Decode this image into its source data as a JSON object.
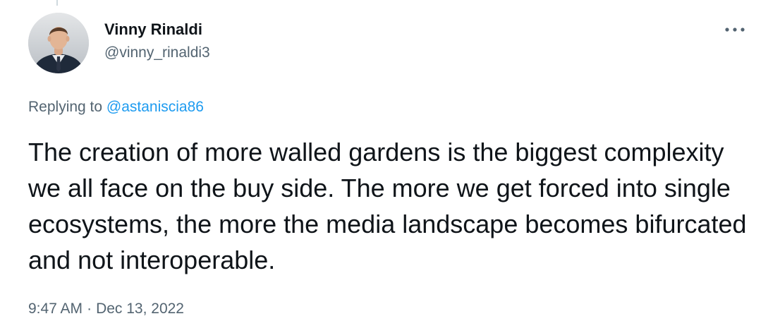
{
  "author": {
    "display_name": "Vinny Rinaldi",
    "handle": "@vinny_rinaldi3"
  },
  "reply": {
    "prefix": "Replying to",
    "mention": "@astaniscia86"
  },
  "tweet": {
    "text": "The creation of more walled gardens is the biggest complexity we all face on the buy side. The more we get forced into single ecosystems, the more the media landscape becomes bifurcated and not interoperable."
  },
  "meta": {
    "time": "9:47 AM",
    "separator": "·",
    "date": "Dec 13, 2022"
  },
  "icons": {
    "more": "more-horizontal-icon"
  },
  "colors": {
    "text_primary": "#0f1419",
    "text_secondary": "#536471",
    "link": "#1d9bf0"
  }
}
